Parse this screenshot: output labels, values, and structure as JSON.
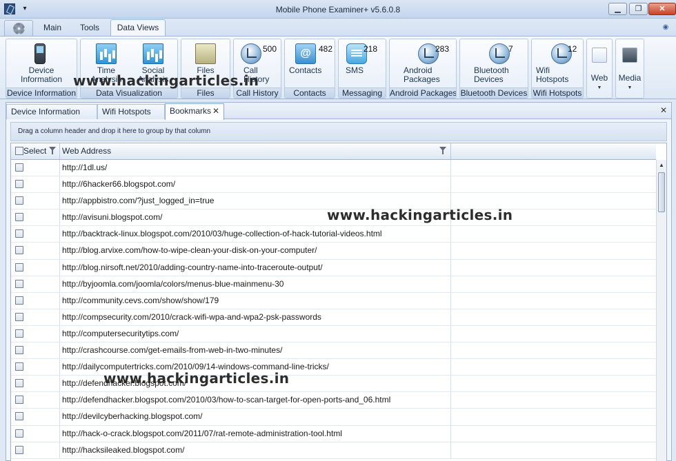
{
  "window": {
    "title": "Mobile Phone Examiner+ v5.6.0.8",
    "minimize": "▁",
    "restore": "❐",
    "close": "✕"
  },
  "ribbon_tabs": [
    "Main",
    "Tools",
    "Data Views"
  ],
  "active_ribbon_tab": "Data Views",
  "ribbon_groups": {
    "device_information": {
      "button": "Device Information",
      "label": "Device Information"
    },
    "data_visualization": {
      "time": "Time Analysis",
      "social": "Social Analysis",
      "label": "Data Visualization"
    },
    "files": {
      "button": "Files",
      "label": "Files"
    },
    "call_history": {
      "button": "Call History",
      "count": "500",
      "label": "Call History"
    },
    "contacts": {
      "button": "Contacts",
      "count": "482",
      "label": "Contacts"
    },
    "messaging": {
      "button": "SMS",
      "count": "218",
      "label": "Messaging"
    },
    "android_packages": {
      "button": "Android Packages",
      "count": "283",
      "label": "Android Packages"
    },
    "bluetooth": {
      "button": "Bluetooth Devices",
      "count": "7",
      "label": "Bluetooth Devices"
    },
    "wifi": {
      "button": "Wifi Hotspots",
      "count": "12",
      "label": "Wifi Hotspots"
    },
    "web": {
      "button": "Web"
    },
    "media": {
      "button": "Media"
    }
  },
  "document_tabs": [
    "Device Information",
    "Wifi Hotspots",
    "Bookmarks"
  ],
  "active_document_tab": "Bookmarks",
  "group_panel_hint": "Drag a column header and drop it here to group by that column",
  "grid": {
    "columns": [
      "Select",
      "Web Address"
    ],
    "rows": [
      "http://1dl.us/",
      "http://6hacker66.blogspot.com/",
      "http://appbistro.com/?just_logged_in=true",
      "http://avisuni.blogspot.com/",
      "http://backtrack-linux.blogspot.com/2010/03/huge-collection-of-hack-tutorial-videos.html",
      "http://blog.arvixe.com/how-to-wipe-clean-your-disk-on-your-computer/",
      "http://blog.nirsoft.net/2010/adding-country-name-into-traceroute-output/",
      "http://byjoomla.com/joomla/colors/menus-blue-mainmenu-30",
      "http://community.cevs.com/show/show/179",
      "http://compsecurity.com/2010/crack-wifi-wpa-and-wpa2-psk-passwords",
      "http://computersecuritytips.com/",
      "http://crashcourse.com/get-emails-from-web-in-two-minutes/",
      "http://dailycomputertricks.com/2010/09/14-windows-command-line-tricks/",
      "http://defendhacker.blogspot.com/",
      "http://defendhacker.blogspot.com/2010/03/how-to-scan-target-for-open-ports-and_06.html",
      "http://devilcyberhacking.blogspot.com/",
      "http://hack-o-crack.blogspot.com/2011/07/rat-remote-administration-tool.html",
      "http://hacksileaked.blogspot.com/"
    ]
  },
  "watermarks": [
    "www.hackingarticles.in",
    "www.hackingarticles.in",
    "www.hackingarticles.in"
  ],
  "colors": {
    "accent": "#2b4f7e",
    "ribbon": "#dfe9f5",
    "close": "#c7432b"
  }
}
